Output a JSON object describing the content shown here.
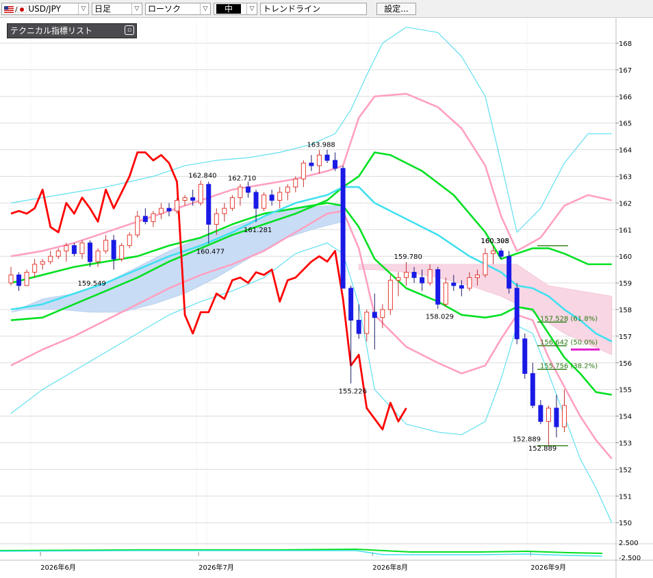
{
  "toolbar": {
    "symbol": "USD/JPY",
    "timeframe": "日足",
    "chart_style": "ローソク",
    "line_weight": "中",
    "drawing_tool": "トレンドライン",
    "settings_label": "設定..."
  },
  "indicator_panel": {
    "title": "テクニカル指標リスト"
  },
  "colors": {
    "up_candle": "#e8392f",
    "down_candle": "#1a1ae6",
    "chikou": "#ff0000",
    "kumo": "#c9dcf5",
    "bollinger_mid": "#00e020",
    "bollinger_1sigma": "#ffa0c0",
    "bollinger_2sigma": "#60e0f0",
    "ma": "#40e0f0"
  },
  "chart_data": {
    "type": "candlestick",
    "y_ticks": [
      "150",
      "151",
      "152",
      "153",
      "154",
      "155",
      "156",
      "157",
      "158",
      "159",
      "160",
      "161",
      "162",
      "163",
      "164",
      "165",
      "166",
      "167",
      "168"
    ],
    "ylim": [
      149.6,
      168.6
    ],
    "x_labels": [
      {
        "label": "2026年6月",
        "index": 2
      },
      {
        "label": "2026年7月",
        "index": 22
      },
      {
        "label": "2026年8月",
        "index": 44
      },
      {
        "label": "2026年9月",
        "index": 64
      }
    ],
    "candles": [
      [
        159.0,
        159.6,
        158.9,
        159.3
      ],
      [
        159.3,
        159.4,
        158.7,
        158.9
      ],
      [
        158.9,
        159.5,
        158.9,
        159.4
      ],
      [
        159.4,
        159.9,
        159.2,
        159.7
      ],
      [
        159.7,
        159.9,
        159.5,
        159.8
      ],
      [
        159.8,
        160.2,
        159.7,
        160.0
      ],
      [
        160.0,
        160.3,
        159.9,
        160.2
      ],
      [
        160.2,
        160.5,
        159.8,
        160.4
      ],
      [
        160.4,
        160.5,
        160.0,
        160.1
      ],
      [
        160.1,
        160.6,
        159.9,
        160.5
      ],
      [
        160.5,
        160.6,
        159.6,
        159.8
      ],
      [
        159.8,
        160.3,
        159.6,
        160.2
      ],
      [
        160.2,
        160.8,
        160.1,
        160.6
      ],
      [
        160.6,
        160.8,
        159.5,
        159.9
      ],
      [
        159.9,
        160.5,
        159.8,
        160.4
      ],
      [
        160.4,
        160.9,
        160.3,
        160.8
      ],
      [
        160.8,
        161.7,
        160.7,
        161.5
      ],
      [
        161.5,
        161.8,
        161.2,
        161.3
      ],
      [
        161.3,
        161.7,
        161.1,
        161.6
      ],
      [
        161.6,
        162.0,
        161.4,
        161.8
      ],
      [
        161.8,
        162.0,
        161.5,
        161.7
      ],
      [
        161.7,
        162.2,
        161.6,
        162.1
      ],
      [
        162.1,
        162.3,
        161.9,
        162.2
      ],
      [
        162.2,
        162.5,
        161.9,
        162.1
      ],
      [
        162.0,
        162.84,
        161.9,
        162.7
      ],
      [
        162.7,
        162.8,
        160.477,
        161.2
      ],
      [
        161.2,
        161.8,
        160.8,
        161.6
      ],
      [
        161.6,
        162.0,
        161.3,
        161.8
      ],
      [
        161.8,
        162.3,
        161.7,
        162.2
      ],
      [
        162.2,
        162.71,
        161.9,
        162.6
      ],
      [
        162.6,
        162.8,
        162.2,
        162.4
      ],
      [
        162.4,
        162.5,
        161.281,
        161.8
      ],
      [
        161.8,
        162.4,
        161.7,
        162.3
      ],
      [
        162.3,
        162.5,
        161.9,
        162.1
      ],
      [
        162.1,
        162.6,
        161.8,
        162.4
      ],
      [
        162.4,
        162.7,
        162.1,
        162.6
      ],
      [
        162.6,
        163.0,
        162.4,
        162.9
      ],
      [
        162.9,
        163.6,
        162.6,
        163.5
      ],
      [
        163.5,
        163.8,
        163.2,
        163.4
      ],
      [
        163.4,
        163.988,
        163.1,
        163.8
      ],
      [
        163.8,
        164.0,
        163.5,
        163.6
      ],
      [
        163.6,
        163.9,
        163.2,
        163.3
      ],
      [
        163.3,
        163.4,
        158.8,
        158.8
      ],
      [
        158.8,
        158.9,
        155.226,
        157.6
      ],
      [
        157.6,
        158.2,
        156.9,
        157.1
      ],
      [
        157.1,
        158.0,
        156.8,
        157.9
      ],
      [
        157.9,
        158.6,
        156.5,
        157.7
      ],
      [
        157.7,
        158.2,
        157.3,
        158.0
      ],
      [
        158.0,
        159.3,
        157.8,
        159.1
      ],
      [
        159.1,
        159.4,
        158.5,
        159.2
      ],
      [
        159.2,
        159.78,
        158.9,
        159.4
      ],
      [
        159.4,
        159.6,
        159.0,
        159.2
      ],
      [
        159.2,
        159.5,
        158.7,
        159.0
      ],
      [
        159.0,
        159.7,
        158.9,
        159.5
      ],
      [
        159.5,
        159.6,
        158.029,
        158.2
      ],
      [
        158.2,
        159.2,
        158.1,
        159.0
      ],
      [
        159.0,
        159.3,
        158.7,
        158.9
      ],
      [
        158.9,
        159.1,
        158.5,
        158.8
      ],
      [
        158.8,
        159.4,
        158.7,
        159.2
      ],
      [
        159.2,
        159.5,
        158.9,
        159.3
      ],
      [
        159.3,
        160.3,
        159.2,
        160.1
      ],
      [
        160.1,
        160.395,
        159.7,
        160.2
      ],
      [
        160.2,
        160.3,
        159.9,
        160.0
      ],
      [
        160.0,
        160.2,
        158.6,
        158.8
      ],
      [
        158.8,
        159.0,
        156.7,
        156.9
      ],
      [
        156.9,
        157.1,
        155.4,
        155.6
      ],
      [
        155.6,
        156.0,
        154.3,
        154.4
      ],
      [
        154.4,
        154.6,
        153.7,
        153.8
      ],
      [
        153.8,
        154.4,
        152.889,
        154.3
      ],
      [
        154.3,
        154.8,
        153.2,
        153.6
      ],
      [
        153.6,
        155.0,
        153.4,
        154.4
      ]
    ],
    "chikou": [
      161.6,
      161.7,
      161.6,
      161.8,
      162.5,
      161.1,
      160.9,
      162.0,
      161.6,
      162.2,
      161.8,
      161.3,
      162.5,
      161.8,
      162.4,
      163.0,
      163.9,
      163.9,
      163.6,
      163.8,
      163.5,
      162.8,
      157.8,
      157.1,
      157.9,
      157.9,
      158.6,
      158.4,
      159.1,
      159.2,
      159.0,
      159.4,
      159.3,
      159.5,
      158.3,
      159.1,
      159.2,
      159.5,
      159.8,
      160.0,
      159.8,
      160.2,
      158.4,
      155.9,
      156.3,
      154.3,
      153.9,
      153.5,
      154.5,
      153.8,
      154.3
    ],
    "price_labels": [
      "159.549",
      "162.840",
      "160.477",
      "162.710",
      "161.281",
      "163.988",
      "155.226",
      "159.780",
      "158.029",
      "160.395",
      "160.308",
      "152.889",
      "152.889"
    ],
    "fib_labels": [
      "157.528 (61.8%)",
      "156.642 (50.0%)",
      "155.756 (38.2%)"
    ],
    "oscillator_ticks": [
      "2.500",
      "-2.500"
    ]
  }
}
